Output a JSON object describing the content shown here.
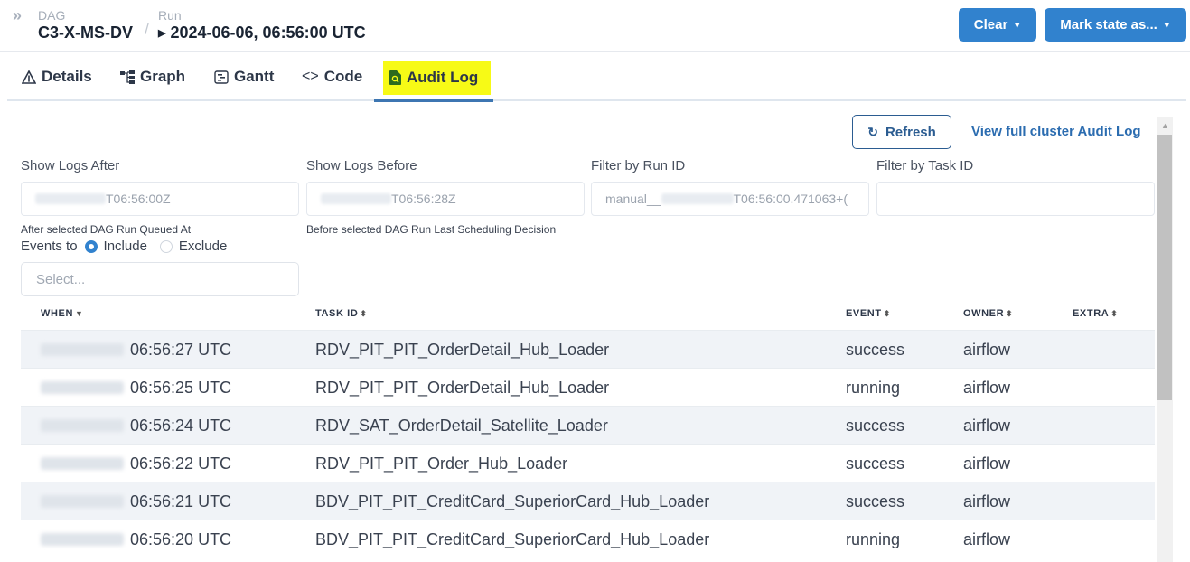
{
  "header": {
    "dag_label": "DAG",
    "dag_value": "C3-X-MS-DV",
    "separator": "/",
    "run_label": "Run",
    "run_value": "2024-06-06, 06:56:00 UTC",
    "clear_label": "Clear",
    "mark_label": "Mark state as..."
  },
  "tabs": [
    {
      "label": "Details",
      "icon": "warning-icon"
    },
    {
      "label": "Graph",
      "icon": "graph-icon"
    },
    {
      "label": "Gantt",
      "icon": "gantt-icon"
    },
    {
      "label": "Code",
      "icon": "code-icon"
    },
    {
      "label": "Audit Log",
      "icon": "audit-log-icon",
      "active": true
    }
  ],
  "actions": {
    "refresh_label": "Refresh",
    "full_log_label": "View full cluster Audit Log"
  },
  "filters": {
    "after_label": "Show Logs After",
    "after_value": "T06:56:00Z",
    "after_help": "After selected DAG Run Queued At",
    "before_label": "Show Logs Before",
    "before_value": "T06:56:28Z",
    "before_help": "Before selected DAG Run Last Scheduling Decision",
    "run_label": "Filter by Run ID",
    "run_value_prefix": "manual__",
    "run_value_suffix": "T06:56:00.471063+(",
    "task_label": "Filter by Task ID",
    "task_value": "",
    "events_label": "Events to",
    "include_label": "Include",
    "exclude_label": "Exclude",
    "select_placeholder": "Select..."
  },
  "table": {
    "headers": {
      "when": "WHEN",
      "task": "TASK ID",
      "event": "EVENT",
      "owner": "OWNER",
      "extra": "EXTRA"
    },
    "rows": [
      {
        "when": "06:56:27 UTC",
        "task": "RDV_PIT_PIT_OrderDetail_Hub_Loader",
        "event": "success",
        "owner": "airflow"
      },
      {
        "when": "06:56:25 UTC",
        "task": "RDV_PIT_PIT_OrderDetail_Hub_Loader",
        "event": "running",
        "owner": "airflow"
      },
      {
        "when": "06:56:24 UTC",
        "task": "RDV_SAT_OrderDetail_Satellite_Loader",
        "event": "success",
        "owner": "airflow"
      },
      {
        "when": "06:56:22 UTC",
        "task": "RDV_PIT_PIT_Order_Hub_Loader",
        "event": "success",
        "owner": "airflow"
      },
      {
        "when": "06:56:21 UTC",
        "task": "BDV_PIT_PIT_CreditCard_SuperiorCard_Hub_Loader",
        "event": "success",
        "owner": "airflow"
      },
      {
        "when": "06:56:20 UTC",
        "task": "BDV_PIT_PIT_CreditCard_SuperiorCard_Hub_Loader",
        "event": "running",
        "owner": "airflow"
      }
    ]
  },
  "colors": {
    "primary": "#3182ce",
    "highlight": "#f7fa16",
    "link": "#2b6cb0"
  }
}
